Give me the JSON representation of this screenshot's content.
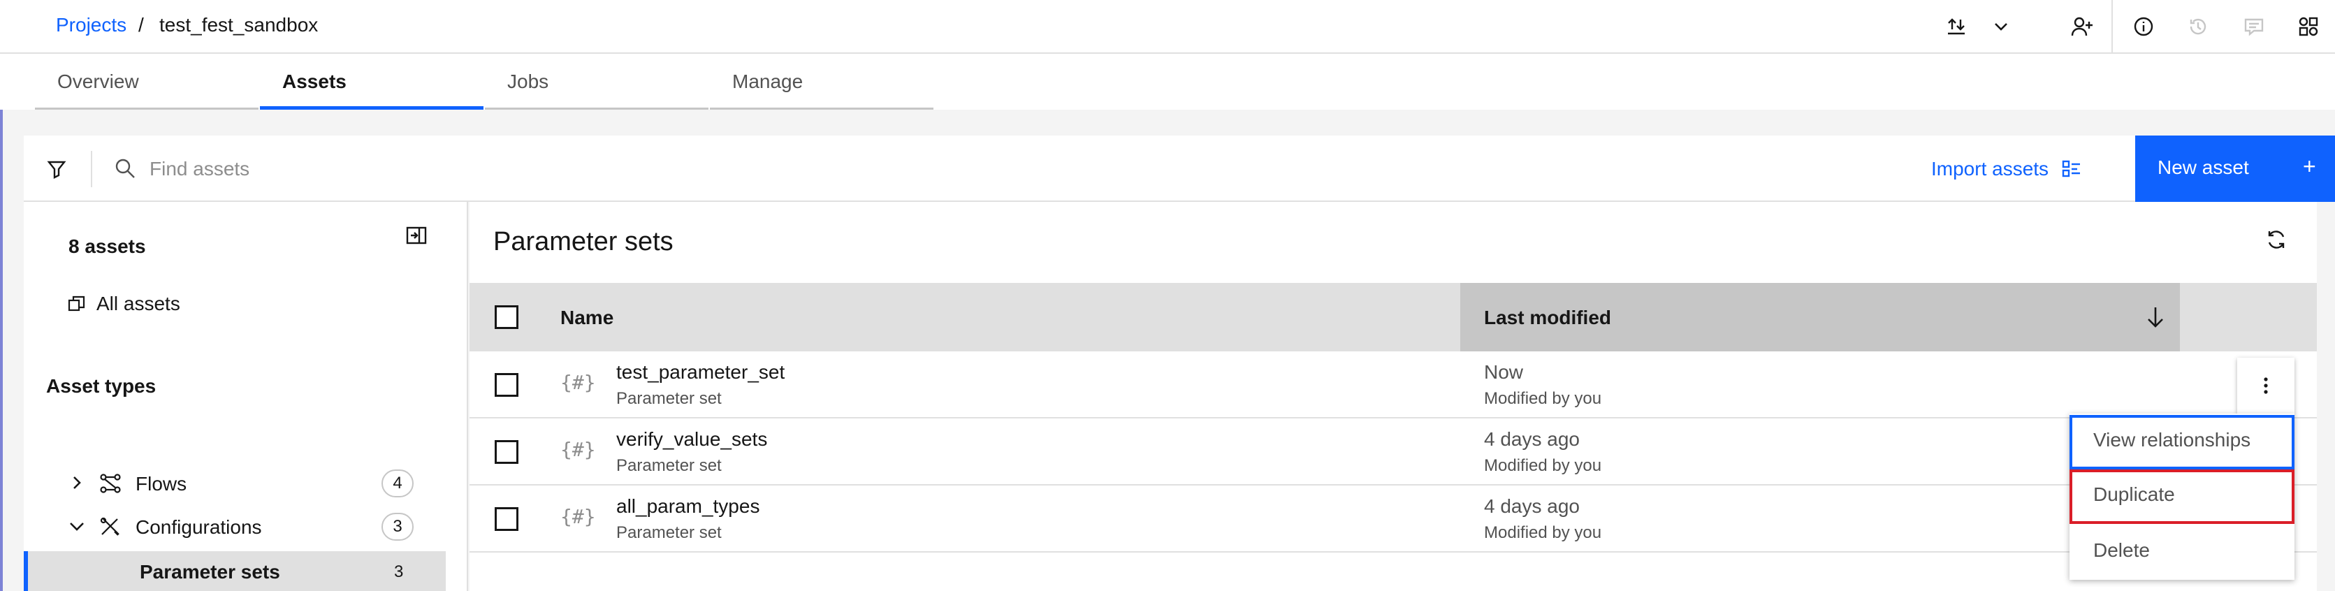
{
  "breadcrumb": {
    "parent": "Projects",
    "separator": "/",
    "current": "test_fest_sandbox"
  },
  "header_icons": [
    "upload-icon",
    "chevron-down-icon",
    "add-collaborator-icon",
    "info-icon",
    "history-icon",
    "comments-icon",
    "apps-icon"
  ],
  "tabs": [
    {
      "label": "Overview",
      "active": false
    },
    {
      "label": "Assets",
      "active": true
    },
    {
      "label": "Jobs",
      "active": false
    },
    {
      "label": "Manage",
      "active": false
    }
  ],
  "toolbar": {
    "search_placeholder": "Find assets",
    "import_label": "Import assets",
    "new_asset_label": "New asset",
    "new_asset_plus": "+"
  },
  "sidebar": {
    "count": "8 assets",
    "all_assets": "All assets",
    "asset_types_heading": "Asset types",
    "tree": [
      {
        "label": "Flows",
        "count": "4",
        "expanded": false
      },
      {
        "label": "Configurations",
        "count": "3",
        "expanded": true
      },
      {
        "label": "Parameter sets",
        "count": "3",
        "selected": true
      }
    ]
  },
  "main": {
    "title": "Parameter sets",
    "columns": {
      "name": "Name",
      "last_modified": "Last modified"
    },
    "rows": [
      {
        "icon": "{#}",
        "name": "test_parameter_set",
        "type": "Parameter set",
        "modified": "Now",
        "by": "Modified by you"
      },
      {
        "icon": "{#}",
        "name": "verify_value_sets",
        "type": "Parameter set",
        "modified": "4 days ago",
        "by": "Modified by you"
      },
      {
        "icon": "{#}",
        "name": "all_param_types",
        "type": "Parameter set",
        "modified": "4 days ago",
        "by": "Modified by you"
      }
    ]
  },
  "overflow_menu": {
    "items": [
      "View relationships",
      "Duplicate",
      "Delete"
    ]
  },
  "colors": {
    "accent": "#0f62fe",
    "highlight": "#da1e28"
  }
}
